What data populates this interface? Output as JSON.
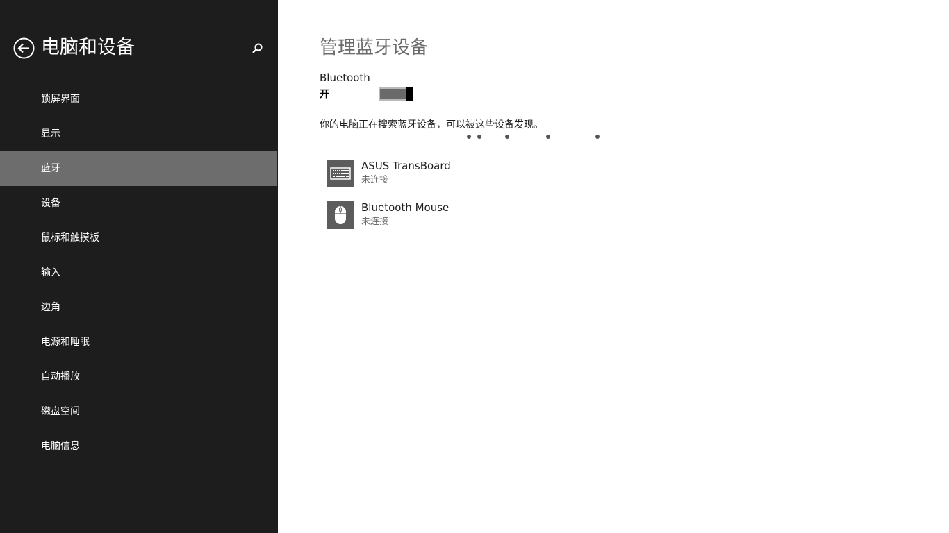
{
  "sidebar": {
    "title": "电脑和设备",
    "back_icon": "back-arrow-circle-icon",
    "search_icon": "search-icon",
    "items": [
      {
        "label": "锁屏界面",
        "selected": false
      },
      {
        "label": "显示",
        "selected": false
      },
      {
        "label": "蓝牙",
        "selected": true
      },
      {
        "label": "设备",
        "selected": false
      },
      {
        "label": "鼠标和触摸板",
        "selected": false
      },
      {
        "label": "输入",
        "selected": false
      },
      {
        "label": "边角",
        "selected": false
      },
      {
        "label": "电源和睡眠",
        "selected": false
      },
      {
        "label": "自动播放",
        "selected": false
      },
      {
        "label": "磁盘空间",
        "selected": false
      },
      {
        "label": "电脑信息",
        "selected": false
      }
    ]
  },
  "main": {
    "title": "管理蓝牙设备",
    "bluetooth": {
      "label": "Bluetooth",
      "state_label": "开",
      "enabled": true
    },
    "status_text": "你的电脑正在搜索蓝牙设备，可以被这些设备发现。",
    "devices": [
      {
        "name": "ASUS TransBoard",
        "status": "未连接",
        "icon": "keyboard-icon"
      },
      {
        "name": "Bluetooth Mouse",
        "status": "未连接",
        "icon": "mouse-icon"
      }
    ]
  },
  "colors": {
    "sidebar_bg": "#1d1d1d",
    "sidebar_selected": "#6d6d6d",
    "main_bg": "#ffffff",
    "title_gray": "#6b6b6b",
    "device_icon_bg": "#5c5c5c"
  }
}
